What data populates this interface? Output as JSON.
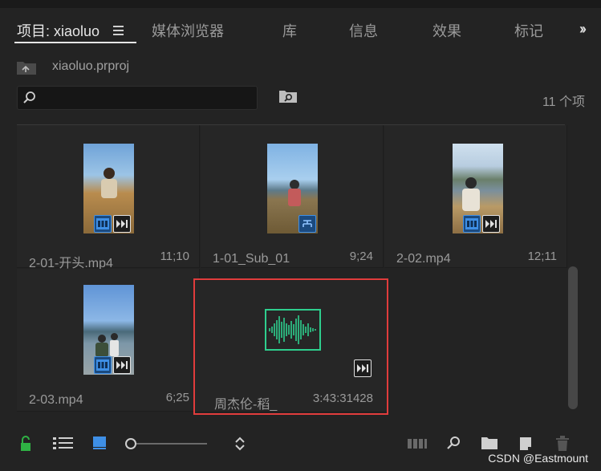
{
  "tabs": [
    {
      "label": "项目: xiaoluo",
      "active": true
    },
    {
      "label": "媒体浏览器"
    },
    {
      "label": "库"
    },
    {
      "label": "信息"
    },
    {
      "label": "效果"
    },
    {
      "label": "标记"
    }
  ],
  "project": {
    "file_name": "xiaoluo.prproj"
  },
  "search": {
    "value": "",
    "placeholder": ""
  },
  "item_count": "11 个项",
  "clips": [
    {
      "name": "2-01-开头.mp4",
      "duration": "11;10",
      "kind": "video"
    },
    {
      "name": "1-01_Sub_01",
      "duration": "9;24",
      "kind": "sequence"
    },
    {
      "name": "2-02.mp4",
      "duration": "12;11",
      "kind": "video"
    },
    {
      "name": "2-03.mp4",
      "duration": "6;25",
      "kind": "video"
    },
    {
      "name": "周杰伦-稻_",
      "duration": "3:43:31428",
      "kind": "audio"
    }
  ],
  "colors": {
    "accent": "#3e8fe6",
    "audio_wave": "#2ecf8e",
    "highlight": "#e03c3c",
    "lock": "#2fb344"
  },
  "watermark": "CSDN @Eastmount"
}
